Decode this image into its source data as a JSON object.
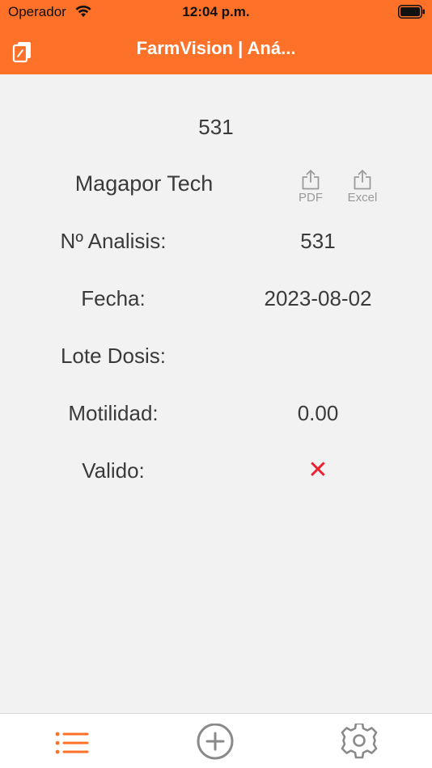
{
  "status_bar": {
    "carrier": "Operador",
    "time": "12:04 p.m."
  },
  "nav": {
    "title": "FarmVision | Aná...",
    "left_icon": "documents-icon"
  },
  "analysis": {
    "id": "531",
    "company": "Magapor Tech",
    "actions": [
      {
        "label": "PDF",
        "icon": "share-icon"
      },
      {
        "label": "Excel",
        "icon": "share-icon"
      }
    ],
    "rows": [
      {
        "label": "Nº Analisis:",
        "value": "531"
      },
      {
        "label": "Fecha:",
        "value": "2023-08-02"
      },
      {
        "label": "Lote Dosis:",
        "value": ""
      },
      {
        "label": "Motilidad:",
        "value": "0.00"
      },
      {
        "label": "Valido:",
        "value": "✕"
      }
    ]
  },
  "tabbar": {
    "items": [
      {
        "name": "list",
        "icon": "list-icon",
        "active": true
      },
      {
        "name": "add",
        "icon": "add-circle-icon",
        "active": false
      },
      {
        "name": "settings",
        "icon": "gear-icon",
        "active": false
      }
    ]
  },
  "colors": {
    "accent": "#fe7128",
    "invalid": "#e8222f",
    "inactive_icon": "#8a8a8a"
  }
}
